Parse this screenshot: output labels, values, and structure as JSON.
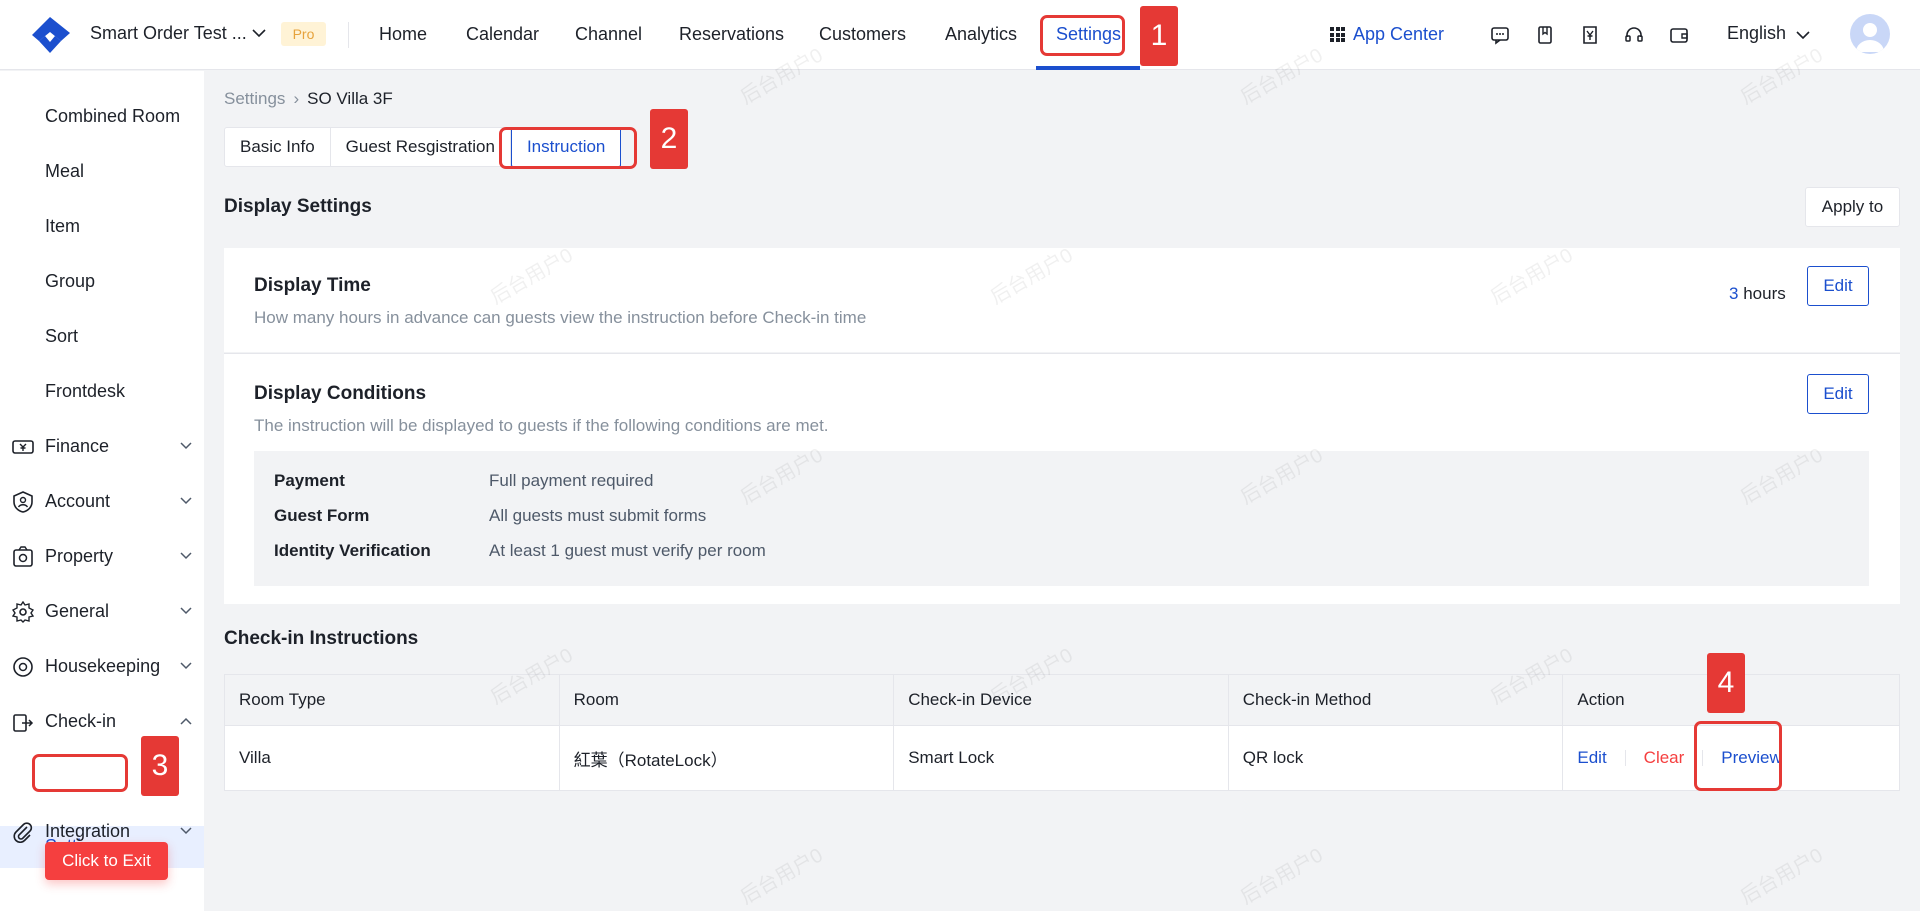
{
  "topbar": {
    "brand": "Smart Order Test ...",
    "badge": "Pro",
    "nav": [
      "Home",
      "Calendar",
      "Channel",
      "Reservations",
      "Customers",
      "Analytics",
      "Settings"
    ],
    "app_center": "App Center",
    "language": "English",
    "icons": [
      "message-icon",
      "bookmark-icon",
      "receipt-yen-icon",
      "headset-icon",
      "wallet-icon"
    ]
  },
  "sidebar": {
    "sub_items": [
      "Combined Room",
      "Meal",
      "Item",
      "Group",
      "Sort",
      "Frontdesk"
    ],
    "groups": [
      {
        "label": "Finance",
        "icon": "finance-icon"
      },
      {
        "label": "Account",
        "icon": "account-icon"
      },
      {
        "label": "Property",
        "icon": "property-icon"
      },
      {
        "label": "General",
        "icon": "gear-icon"
      },
      {
        "label": "Housekeeping",
        "icon": "housekeeping-icon"
      },
      {
        "label": "Check-in",
        "icon": "checkin-icon"
      },
      {
        "label": "Integration",
        "icon": "paperclip-icon"
      }
    ],
    "active_sub": "Settings",
    "exit_label": "Click to Exit"
  },
  "breadcrumb": {
    "root": "Settings",
    "current": "SO Villa 3F"
  },
  "tabs": [
    "Basic Info",
    "Guest Resgistration",
    "Instruction"
  ],
  "display_settings": {
    "title": "Display Settings",
    "apply_label": "Apply to",
    "time": {
      "title": "Display Time",
      "desc": "How many hours in advance can guests view the instruction before Check-in time",
      "value": "3",
      "unit": "hours",
      "edit": "Edit"
    },
    "conditions": {
      "title": "Display Conditions",
      "desc": "The instruction will be displayed to guests if the following conditions are met.",
      "edit": "Edit",
      "rows": [
        {
          "key": "Payment",
          "value": "Full payment required"
        },
        {
          "key": "Guest Form",
          "value": "All guests must submit forms"
        },
        {
          "key": "Identity Verification",
          "value": "At least 1 guest must verify per room"
        }
      ]
    }
  },
  "checkin": {
    "title": "Check-in Instructions",
    "columns": [
      "Room Type",
      "Room",
      "Check-in Device",
      "Check-in Method",
      "Action"
    ],
    "rows": [
      {
        "room_type": "Villa",
        "room": "紅葉（RotateLock）",
        "device": "Smart Lock",
        "method": "QR lock"
      }
    ],
    "actions": {
      "edit": "Edit",
      "clear": "Clear",
      "preview": "Preview"
    }
  },
  "annotations": [
    "1",
    "2",
    "3",
    "4"
  ],
  "watermark": "后台用户0",
  "colors": {
    "accent": "#1b4fce",
    "danger": "#f53f3f",
    "annotation": "#e53935",
    "pro_bg": "#fff3d6"
  }
}
